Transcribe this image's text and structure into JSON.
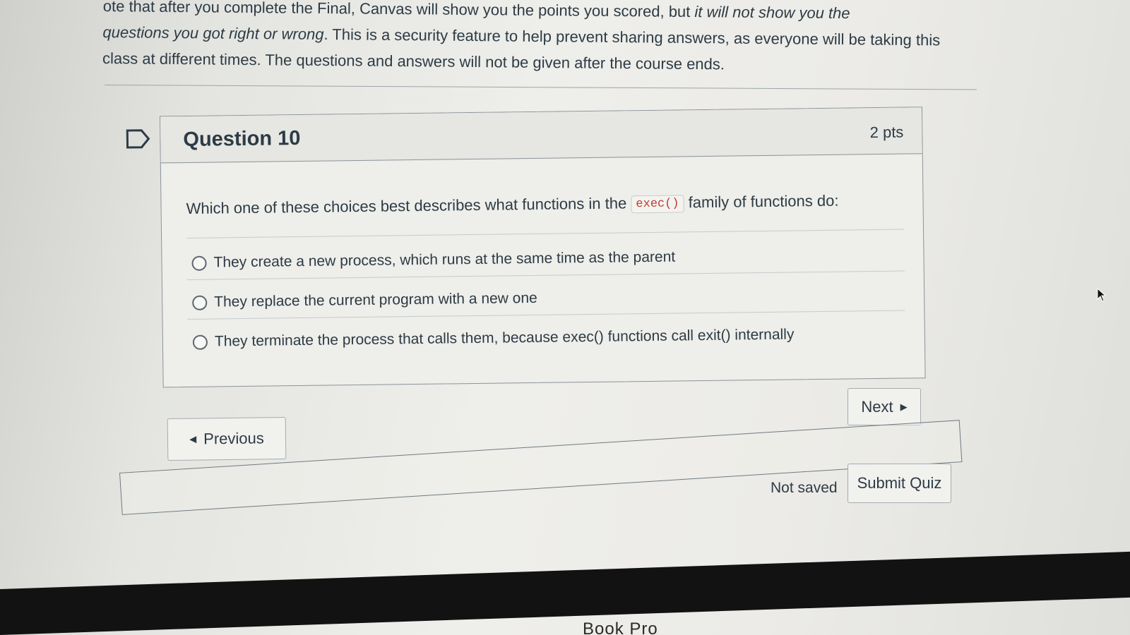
{
  "intro": {
    "line1_fragment": "ote that after you complete the Final, Canvas will show you the points you scored, but ",
    "line1_italic": "it will not show you the",
    "line2_italic": "questions you got right or wrong",
    "line2_rest": ". This is a security feature to help prevent sharing answers, as everyone will be taking this",
    "line3": "class at different times. The questions and answers will not be given after the course ends."
  },
  "question": {
    "title": "Question 10",
    "points": "2 pts",
    "text_before": "Which one of these choices best describes what functions in the",
    "code": "exec()",
    "text_after": "family of functions do:",
    "answers": [
      "They create a new process, which runs at the same time as the parent",
      "They replace the current program with a new one",
      "They terminate the process that calls them, because exec() functions call exit() internally"
    ]
  },
  "navigation": {
    "previous_label": "Previous",
    "next_label": "Next"
  },
  "footer": {
    "status": "Not saved",
    "submit_label": "Submit Quiz"
  },
  "bezel": {
    "text": "Book Pro"
  },
  "icons": {
    "flag": "flag-question-icon",
    "previous_caret": "caret-left-icon",
    "next_caret": "caret-right-icon",
    "cursor": "mouse-cursor-icon"
  },
  "colors": {
    "text": "#2d3b45",
    "code": "#c23c2d",
    "border": "#8a939a"
  }
}
